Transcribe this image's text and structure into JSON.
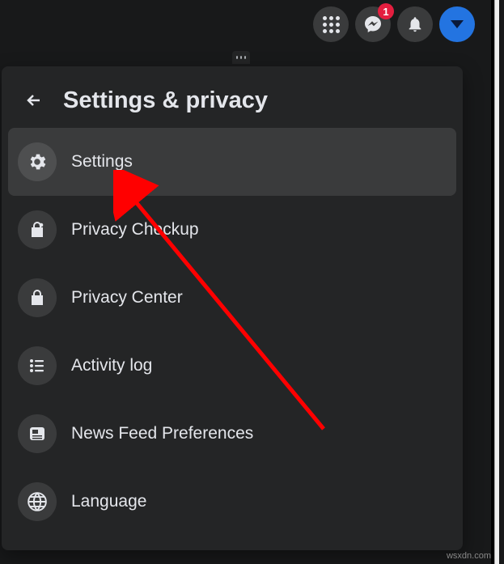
{
  "topbar": {
    "messenger_badge": "1"
  },
  "panel": {
    "title": "Settings & privacy",
    "items": [
      {
        "label": "Settings",
        "icon": "gear-icon",
        "selected": true
      },
      {
        "label": "Privacy Checkup",
        "icon": "lock-heart-icon",
        "selected": false
      },
      {
        "label": "Privacy Center",
        "icon": "lock-icon",
        "selected": false
      },
      {
        "label": "Activity log",
        "icon": "list-icon",
        "selected": false
      },
      {
        "label": "News Feed Preferences",
        "icon": "news-icon",
        "selected": false
      },
      {
        "label": "Language",
        "icon": "globe-icon",
        "selected": false
      }
    ]
  },
  "watermark": "wsxdn.com",
  "colors": {
    "accent": "#2374e1",
    "badge": "#e41e3f",
    "panel": "#242526",
    "hover": "#3a3b3c"
  }
}
